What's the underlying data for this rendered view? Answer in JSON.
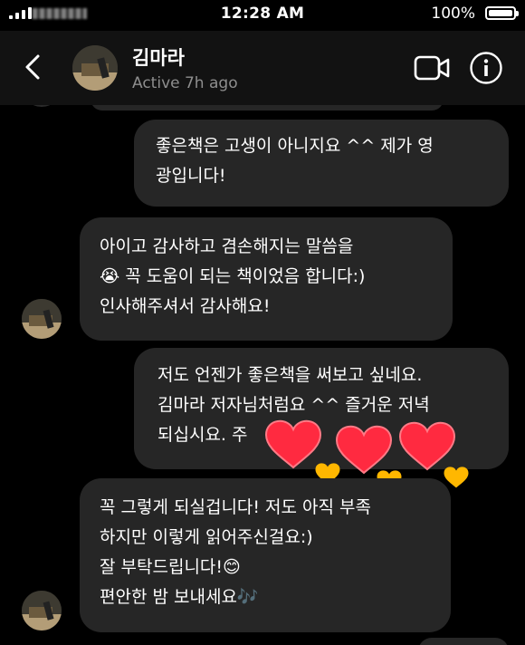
{
  "status_bar": {
    "time": "12:28 AM",
    "battery_percent": "100%",
    "battery_level": 1.0
  },
  "header": {
    "contact_name": "김마라",
    "status": "Active 7h ago"
  },
  "messages": [
    {
      "sender": "me",
      "text": "좋은책은 고생이 아니지요 ^^ 제가 영\n광입니다!"
    },
    {
      "sender": "them",
      "text": "아이고 감사하고 겸손해지는 말씀을\n😭 꼭 도움이 되는 책이었음 합니다:)\n인사해주셔서 감사해요!"
    },
    {
      "sender": "me",
      "text": "저도 언젠가 좋은책을 써보고 싶네요.\n김마라 저자님처럼요 ^^ 즐거운 저녁\n되십시요. 주"
    },
    {
      "sender": "them",
      "text": "꼭 그렇게 되실겁니다! 저도 아직 부족\n하지만 이렇게 읽어주신걸요:)\n잘 부탁드립니다!😊\n편안한 밤 보내세요🎶"
    }
  ],
  "colors": {
    "background": "#000000",
    "header": "#121212",
    "bubble": "#262626",
    "muted_text": "#8e8e8e",
    "heart": "#ff2a40",
    "small_heart": "#ffb700"
  },
  "icons": [
    "back-chevron-icon",
    "video-call-icon",
    "info-icon",
    "heart-sticker-icon"
  ]
}
